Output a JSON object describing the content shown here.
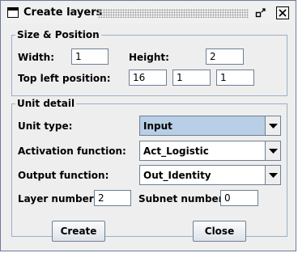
{
  "window": {
    "title": "Create layers",
    "icons": {
      "window": "window-icon",
      "restore": "restore-icon",
      "close": "close-icon"
    }
  },
  "size_position": {
    "legend": "Size & Position",
    "width_label": "Width:",
    "width_value": "1",
    "height_label": "Height:",
    "height_value": "2",
    "top_left_label": "Top left position:",
    "pos_x": "16",
    "pos_y": "1",
    "pos_z": "1"
  },
  "unit_detail": {
    "legend": "Unit detail",
    "unit_type_label": "Unit type:",
    "unit_type_value": "Input",
    "activation_label": "Activation function:",
    "activation_value": "Act_Logistic",
    "output_label": "Output function:",
    "output_value": "Out_Identity",
    "layer_number_label": "Layer number:",
    "layer_number_value": "2",
    "subnet_number_label": "Subnet number:",
    "subnet_number_value": "0"
  },
  "buttons": {
    "create": "Create",
    "close": "Close"
  },
  "colors": {
    "selected_combo": "#b8cfe5",
    "border": "#6e7f94",
    "group_border": "#9ab0c8"
  }
}
